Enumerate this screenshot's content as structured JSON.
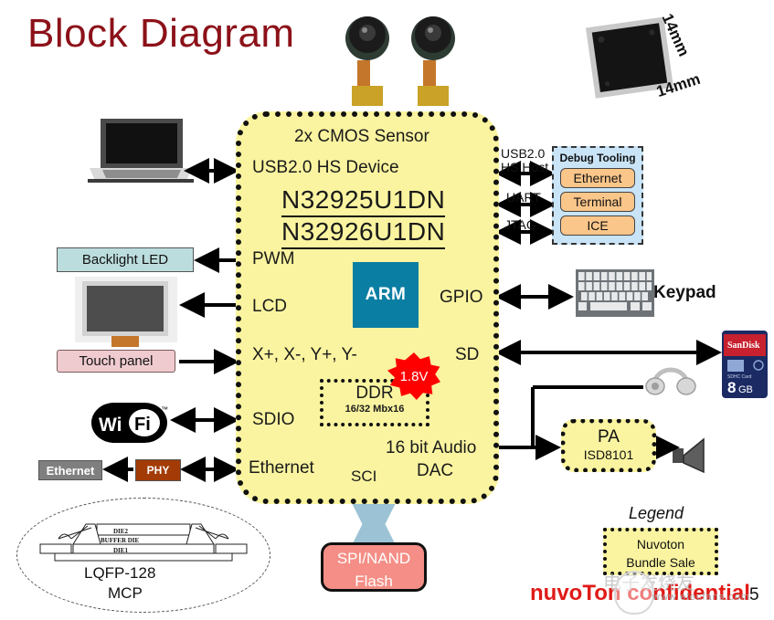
{
  "page": {
    "title": "Block Diagram",
    "page_number": "5",
    "footer": "nuvoTon confidential",
    "watermark_cn": "电子发烧友",
    "watermark_url": "www.elecfans.com"
  },
  "soc": {
    "top_label": "2x CMOS Sensor",
    "usb_device": "USB2.0 HS Device",
    "part_numbers": [
      "N32925U1DN",
      "N32926U1DN"
    ],
    "left_pins": [
      "PWM",
      "LCD",
      "X+, X-, Y+, Y-",
      "SDIO",
      "Ethernet"
    ],
    "right_pins": [
      "GPIO",
      "SD"
    ],
    "audio_label": "16 bit Audio",
    "dac_label": "DAC",
    "sci_label": "SCI",
    "core_logo": "ARM",
    "core_logo_tm": "®",
    "ddr": {
      "title": "DDR",
      "sub": "16/32 Mbx16"
    },
    "voltage_badge": "1.8V"
  },
  "debug_tooling": {
    "title": "Debug Tooling",
    "items": [
      "Ethernet",
      "Terminal",
      "ICE"
    ],
    "bus_labels": [
      "USB2.0",
      "HS Host",
      "UART",
      "JTAG"
    ]
  },
  "peripherals": {
    "backlight_led": "Backlight LED",
    "touch_panel": "Touch panel",
    "ethernet": "Ethernet",
    "phy": "PHY",
    "keypad": "Keypad",
    "wifi_logo": "Wi Fi",
    "wifi_tm": "™",
    "sd_card": {
      "brand": "SanDisk",
      "capacity": "8",
      "unit": "GB",
      "type": "SDHC Card"
    }
  },
  "pa": {
    "title": "PA",
    "part": "ISD8101"
  },
  "flash": {
    "line1": "SPI/NAND",
    "line2": "Flash"
  },
  "legend": {
    "title": "Legend",
    "line1": "Nuvoton",
    "line2": "Bundle  Sale"
  },
  "package": {
    "name": "LQFP-128",
    "sub": "MCP",
    "die_labels": [
      "DIE2",
      "BUFFER DIE",
      "DIE1"
    ]
  },
  "chip_photo": {
    "dim_width": "14mm",
    "dim_height": "14mm"
  },
  "colors": {
    "title": "#8C1119",
    "soc_fill": "#FAF4A0",
    "arm_blue": "#0A7EA3",
    "voltage_red": "#FF0000",
    "debug_fill": "#C9E4F7",
    "debug_btn": "#FBC68A",
    "flash_fill": "#F48E86",
    "footer_red": "#E01B17"
  }
}
